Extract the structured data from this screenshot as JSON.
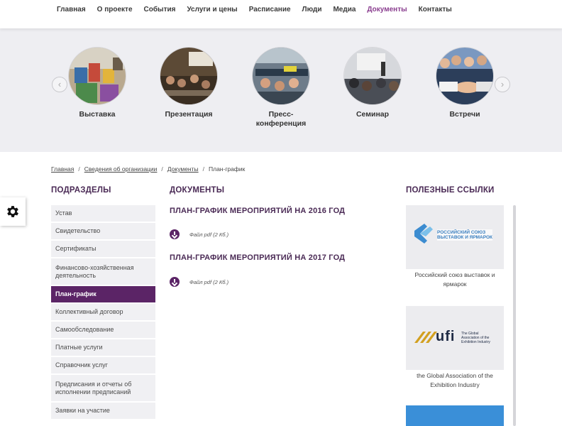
{
  "nav": {
    "items": [
      "Главная",
      "О проекте",
      "События",
      "Услуги и цены",
      "Расписание",
      "Люди",
      "Медиа",
      "Документы",
      "Контакты"
    ],
    "active_index": 7,
    "active_color": "#8a3e8f"
  },
  "carousel": {
    "items": [
      {
        "label": "Выставка"
      },
      {
        "label": "Презентация"
      },
      {
        "label": "Пресс-конференция"
      },
      {
        "label": "Семинар"
      },
      {
        "label": "Встречи"
      }
    ],
    "prev_icon": "chevron-left-icon",
    "next_icon": "chevron-right-icon"
  },
  "breadcrumb": [
    "Главная",
    "Сведения об организации",
    "Документы",
    "План-график"
  ],
  "sidebar": {
    "title": "ПОДРАЗДЕЛЫ",
    "items": [
      "Устав",
      "Свидетельство",
      "Сертификаты",
      "Финансово-хозяйственная деятельность",
      "План-график",
      "Коллективный договор",
      "Самообследование",
      "Платные услуги",
      "Справочник услуг",
      "Предписания и отчеты об исполнении предписаний",
      "Заявки на участие"
    ],
    "active_index": 4,
    "active_color": "#5b2466"
  },
  "documents": {
    "title": "ДОКУМЕНТЫ",
    "items": [
      {
        "title": "ПЛАН-ГРАФИК МЕРОПРИЯТИЙ НА 2016 ГОД",
        "file": "Файл pdf (2 Кб.)"
      },
      {
        "title": "ПЛАН-ГРАФИК МЕРОПРИЯТИЙ НА 2017 ГОД",
        "file": "Файл pdf (2 Кб.)"
      }
    ]
  },
  "links": {
    "title": "ПОЛЕЗНЫЕ ССЫЛКИ",
    "items": [
      {
        "caption": "Российский союз выставок и ярмарок",
        "logo_text": "РОССИЙСКИЙ СОЮЗ ВЫСТАВОК И ЯРМАРОК"
      },
      {
        "caption": "the Global Association of the Exhibition Industry",
        "logo_text": "ufi",
        "logo_sub": "The Global Association of the Exhibition Industry"
      }
    ]
  },
  "settings": {
    "icon": "gear-icon"
  }
}
